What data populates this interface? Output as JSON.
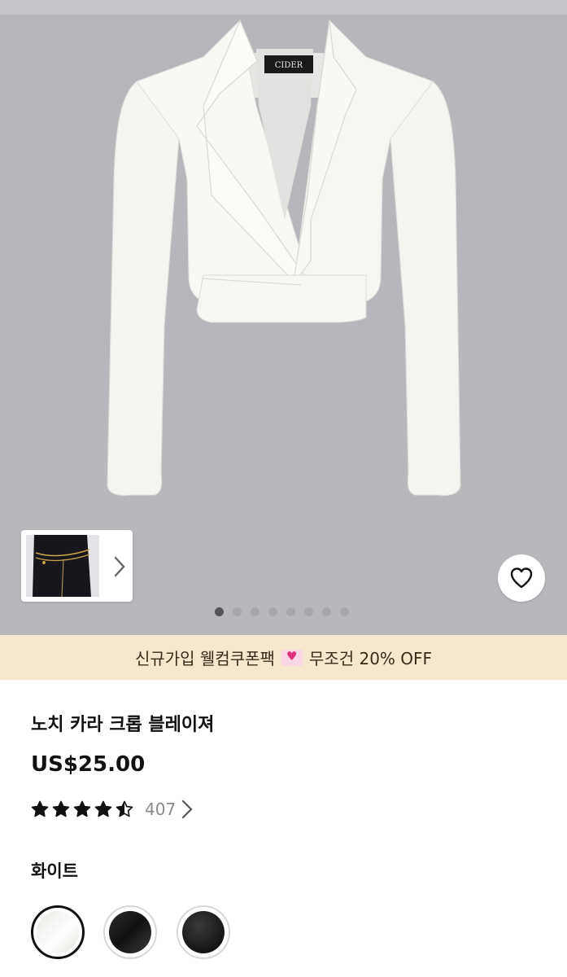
{
  "gallery": {
    "brand_label": "CIDER",
    "image_count": 8,
    "active_index": 0
  },
  "promo": {
    "text_before": "신규가입 웰컴쿠폰팩",
    "icon": "gift-heart-icon",
    "text_after": "무조건 20% OFF"
  },
  "product": {
    "title": "노치 카라 크롭 블레이져",
    "price": "US$25.00",
    "rating": 4.5,
    "review_count": "407"
  },
  "color": {
    "selected_label": "화이트",
    "swatches": [
      {
        "name": "white",
        "hex": "#f2f1ee",
        "selected": true
      },
      {
        "name": "black-textured",
        "hex": "#1c1c1c",
        "selected": false
      },
      {
        "name": "black",
        "hex": "#222222",
        "selected": false
      }
    ]
  }
}
